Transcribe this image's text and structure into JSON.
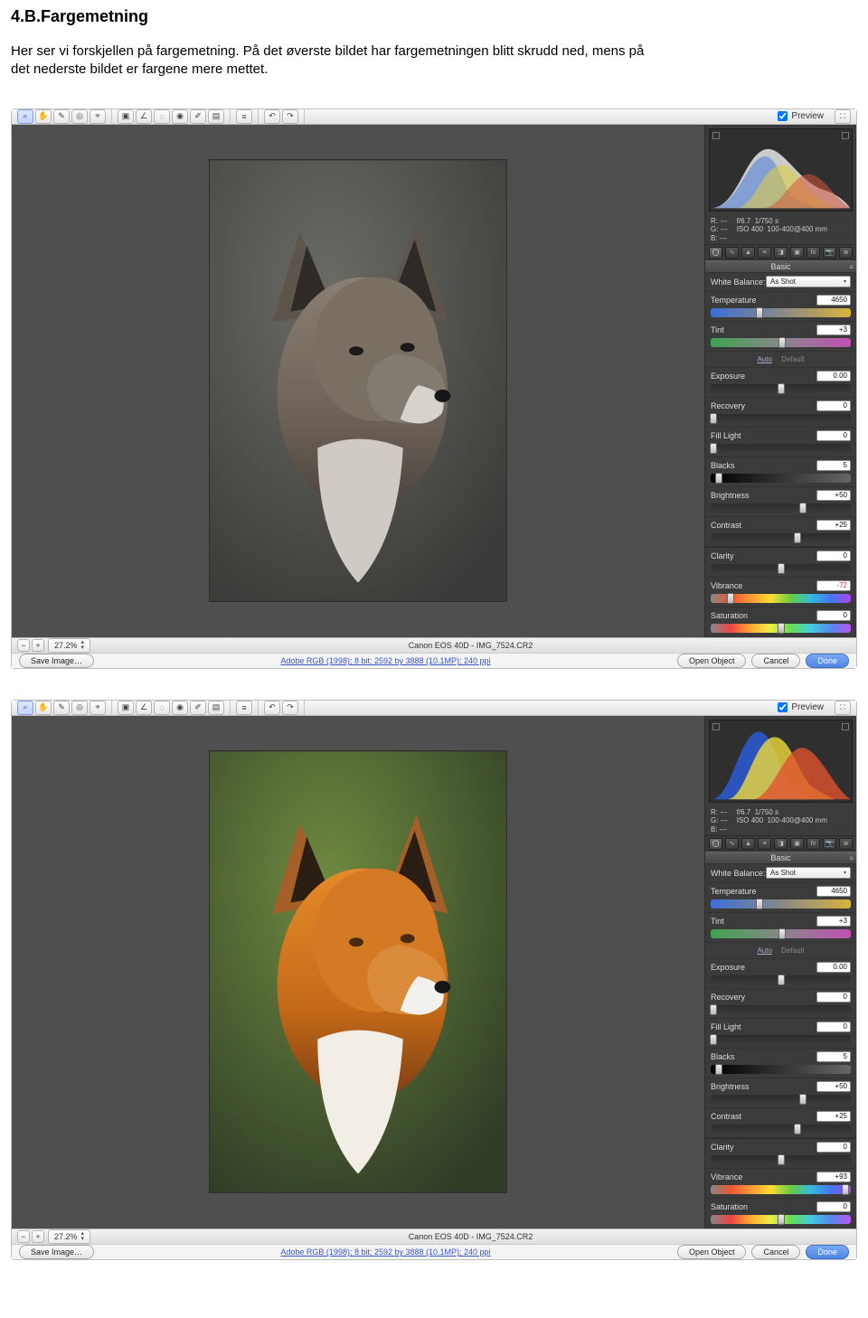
{
  "doc": {
    "heading": "4.B.Fargemetning",
    "body": "Her ser vi forskjellen på fargemetning. På det øverste bildet har fargemetningen blitt skrudd ned, mens på det nederste bildet er fargene mere mettet."
  },
  "common": {
    "preview_label": "Preview",
    "zoom": "27.2%",
    "camera_title": "Canon EOS 40D  -  IMG_7524.CR2",
    "save_image": "Save Image…",
    "meta_link": "Adobe RGB (1998); 8 bit; 2592 by 3888 (10.1MP); 240 ppi",
    "open_object": "Open Object",
    "cancel": "Cancel",
    "done": "Done",
    "cam": {
      "r": "R:",
      "g": "G:",
      "b": "B:",
      "r_val": "---",
      "g_val": "---",
      "b_val": "---",
      "f": "f/6.7",
      "shutter": "1/750 s",
      "iso": "ISO 400",
      "lens": "100-400@400 mm"
    },
    "section_basic": "Basic",
    "wb_label": "White Balance:",
    "wb_value": "As Shot",
    "temp_label": "Temperature",
    "tint_label": "Tint",
    "auto": "Auto",
    "default": "Default",
    "exposure_label": "Exposure",
    "recovery_label": "Recovery",
    "filllight_label": "Fill Light",
    "blacks_label": "Blacks",
    "brightness_label": "Brightness",
    "contrast_label": "Contrast",
    "clarity_label": "Clarity",
    "vibrance_label": "Vibrance",
    "saturation_label": "Saturation"
  },
  "top": {
    "temperature": "4650",
    "tint": "+3",
    "exposure": "0.00",
    "recovery": "0",
    "filllight": "0",
    "blacks": "5",
    "brightness": "+50",
    "contrast": "+25",
    "clarity": "0",
    "vibrance": "-72",
    "saturation": "0",
    "vibrance_thumb_pct": 14
  },
  "bottom": {
    "temperature": "4650",
    "tint": "+3",
    "exposure": "0.00",
    "recovery": "0",
    "filllight": "0",
    "blacks": "5",
    "brightness": "+50",
    "contrast": "+25",
    "clarity": "0",
    "vibrance": "+93",
    "saturation": "0",
    "vibrance_thumb_pct": 96
  }
}
